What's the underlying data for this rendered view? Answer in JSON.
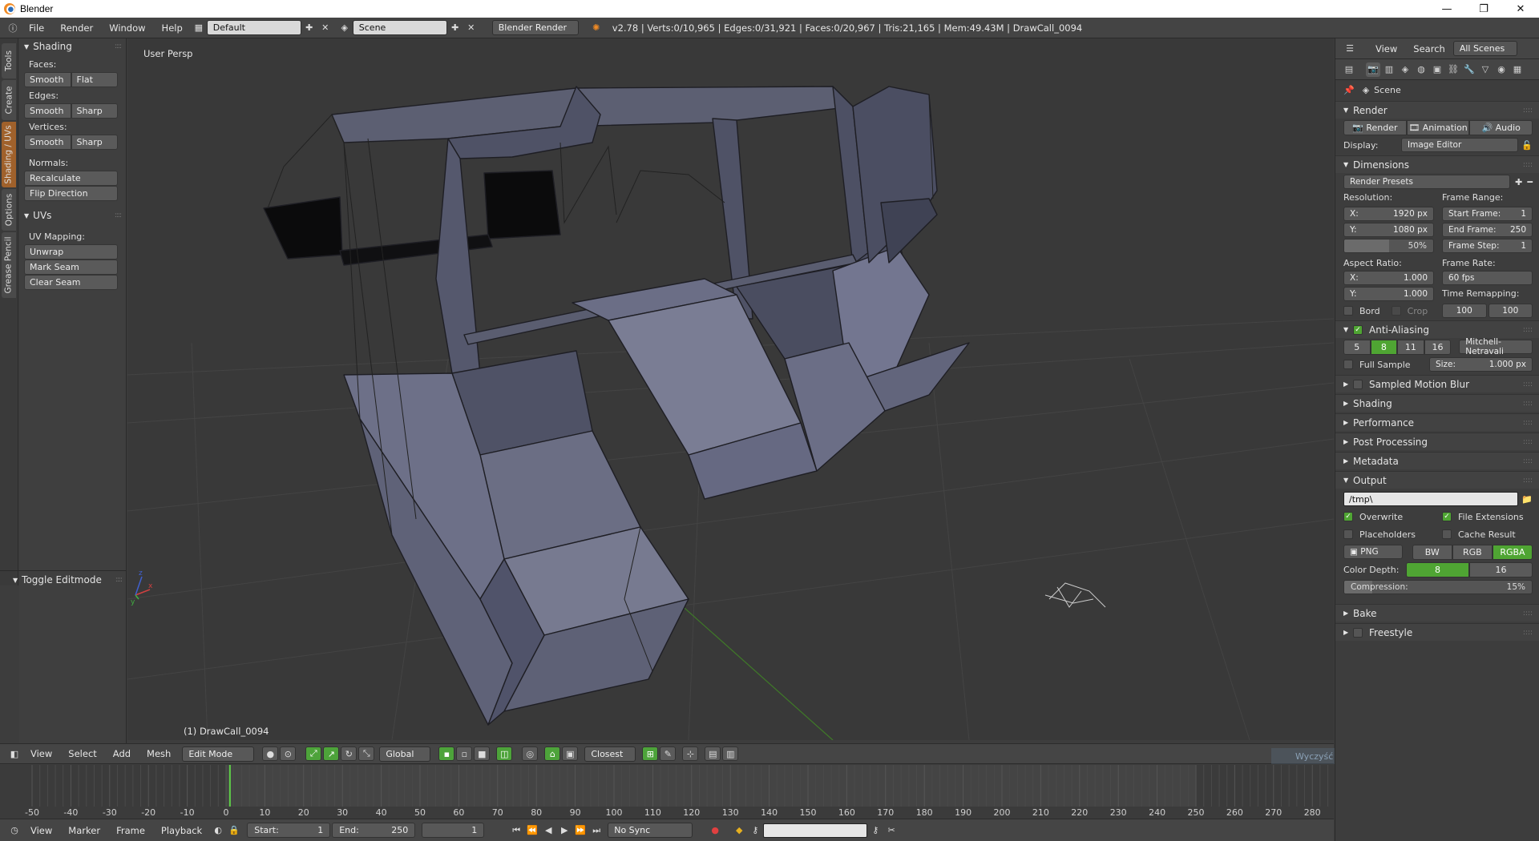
{
  "window": {
    "title": "Blender",
    "minimize": "—",
    "maximize": "❐",
    "close": "✕"
  },
  "info": {
    "menus": [
      "File",
      "Render",
      "Window",
      "Help"
    ],
    "layout": "Default",
    "scene": "Scene",
    "engine": "Blender Render",
    "stats": "v2.78 | Verts:0/10,965 | Edges:0/31,921 | Faces:0/20,967 | Tris:21,165 | Mem:49.43M | DrawCall_0094"
  },
  "toolshelf": {
    "tabs": [
      "Tools",
      "Create",
      "Shading / UVs",
      "Options",
      "Grease Pencil"
    ],
    "active_tab": "Shading / UVs",
    "shading_panel": "Shading",
    "faces_label": "Faces:",
    "faces_btns": [
      "Smooth",
      "Flat"
    ],
    "edges_label": "Edges:",
    "edges_btns": [
      "Smooth",
      "Sharp"
    ],
    "vertices_label": "Vertices:",
    "vertices_btns": [
      "Smooth",
      "Sharp"
    ],
    "normals_label": "Normals:",
    "recalculate": "Recalculate",
    "flip": "Flip Direction",
    "uvs_panel": "UVs",
    "uv_mapping_label": "UV Mapping:",
    "unwrap": "Unwrap",
    "mark_seam": "Mark Seam",
    "clear_seam": "Clear Seam",
    "operator_panel": "Toggle Editmode"
  },
  "viewport": {
    "view_label": "User Persp",
    "object_label": "(1) DrawCall_0094",
    "header": {
      "menus": [
        "View",
        "Select",
        "Add",
        "Mesh"
      ],
      "mode": "Edit Mode",
      "orientation": "Global",
      "snap": "Closest"
    }
  },
  "timeline": {
    "ticks": [
      "-50",
      "-40",
      "-30",
      "-20",
      "-10",
      "0",
      "10",
      "20",
      "30",
      "40",
      "50",
      "60",
      "70",
      "80",
      "90",
      "100",
      "110",
      "120",
      "130",
      "140",
      "150",
      "160",
      "170",
      "180",
      "190",
      "200",
      "210",
      "220",
      "230",
      "240",
      "250",
      "260",
      "270",
      "280"
    ],
    "current_frame_value": 1,
    "menus": [
      "View",
      "Marker",
      "Frame",
      "Playback"
    ],
    "start_label": "Start:",
    "start": "1",
    "end_label": "End:",
    "end": "250",
    "current": "1",
    "sync": "No Sync"
  },
  "properties": {
    "header": {
      "view": "View",
      "search": "Search",
      "filter": "All Scenes"
    },
    "context": "Scene",
    "render": {
      "title": "Render",
      "btn_render": "Render",
      "btn_animation": "Animation",
      "btn_audio": "Audio",
      "display_label": "Display:",
      "display": "Image Editor"
    },
    "dimensions": {
      "title": "Dimensions",
      "presets": "Render Presets",
      "resolution_label": "Resolution:",
      "res_x_label": "X:",
      "res_x": "1920 px",
      "res_y_label": "Y:",
      "res_y": "1080 px",
      "res_pct": "50%",
      "res_pct_value": 0.5,
      "frame_range_label": "Frame Range:",
      "start_label": "Start Frame:",
      "start": "1",
      "end_label": "End Frame:",
      "end": "250",
      "step_label": "Frame Step:",
      "step": "1",
      "aspect_label": "Aspect Ratio:",
      "asp_x_label": "X:",
      "asp_x": "1.000",
      "asp_y_label": "Y:",
      "asp_y": "1.000",
      "frame_rate_label": "Frame Rate:",
      "frame_rate": "60 fps",
      "remap_label": "Time Remapping:",
      "remap_old": "100",
      "remap_new": "100",
      "bord": "Bord",
      "crop": "Crop"
    },
    "aa": {
      "title": "Anti-Aliasing",
      "samples": [
        "5",
        "8",
        "11",
        "16"
      ],
      "active_sample": "8",
      "filter": "Mitchell-Netravali",
      "full_sample": "Full Sample",
      "size_label": "Size:",
      "size": "1.000 px"
    },
    "collapsed": [
      "Sampled Motion Blur",
      "Shading",
      "Performance",
      "Post Processing",
      "Metadata"
    ],
    "output": {
      "title": "Output",
      "path": "/tmp\\",
      "overwrite": "Overwrite",
      "file_ext": "File Extensions",
      "placeholders": "Placeholders",
      "cache": "Cache Result",
      "format": "PNG",
      "channels": [
        "BW",
        "RGB",
        "RGBA"
      ],
      "active_channel": "RGBA",
      "depth_label": "Color Depth:",
      "depth": [
        "8",
        "16"
      ],
      "active_depth": "8",
      "compression_label": "Compression:",
      "compression": "15%",
      "compression_value": 0.15
    },
    "bake": "Bake",
    "freestyle": "Freestyle"
  },
  "ghost_text": "Wyczyść miej",
  "colors": {
    "accent_green": "#4fa533",
    "active_tab": "#a0612b",
    "mesh_face": "#6c6f86"
  }
}
